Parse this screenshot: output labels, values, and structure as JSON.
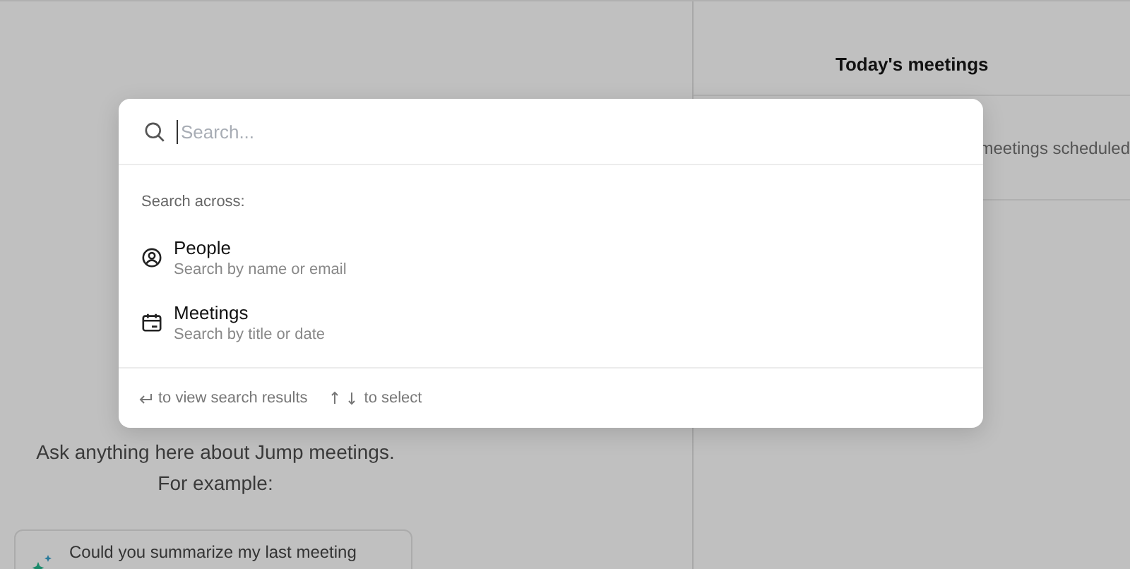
{
  "left_panel": {
    "intro": "Ask anything here about Jump meetings.",
    "intro_example": "For example:",
    "example_prompts": [
      "Could you summarize my last meeting"
    ]
  },
  "right_panel": {
    "title": "Today's meetings",
    "empty_text": "meetings scheduled"
  },
  "search_dialog": {
    "placeholder": "Search...",
    "section_label": "Search across:",
    "options": [
      {
        "kind": "people",
        "title": "People",
        "subtitle": "Search by name or email"
      },
      {
        "kind": "meetings",
        "title": "Meetings",
        "subtitle": "Search by title or date"
      }
    ],
    "hints": [
      {
        "kind": "enter",
        "text": "to view search results"
      },
      {
        "kind": "arrows",
        "text": "to select"
      }
    ]
  }
}
